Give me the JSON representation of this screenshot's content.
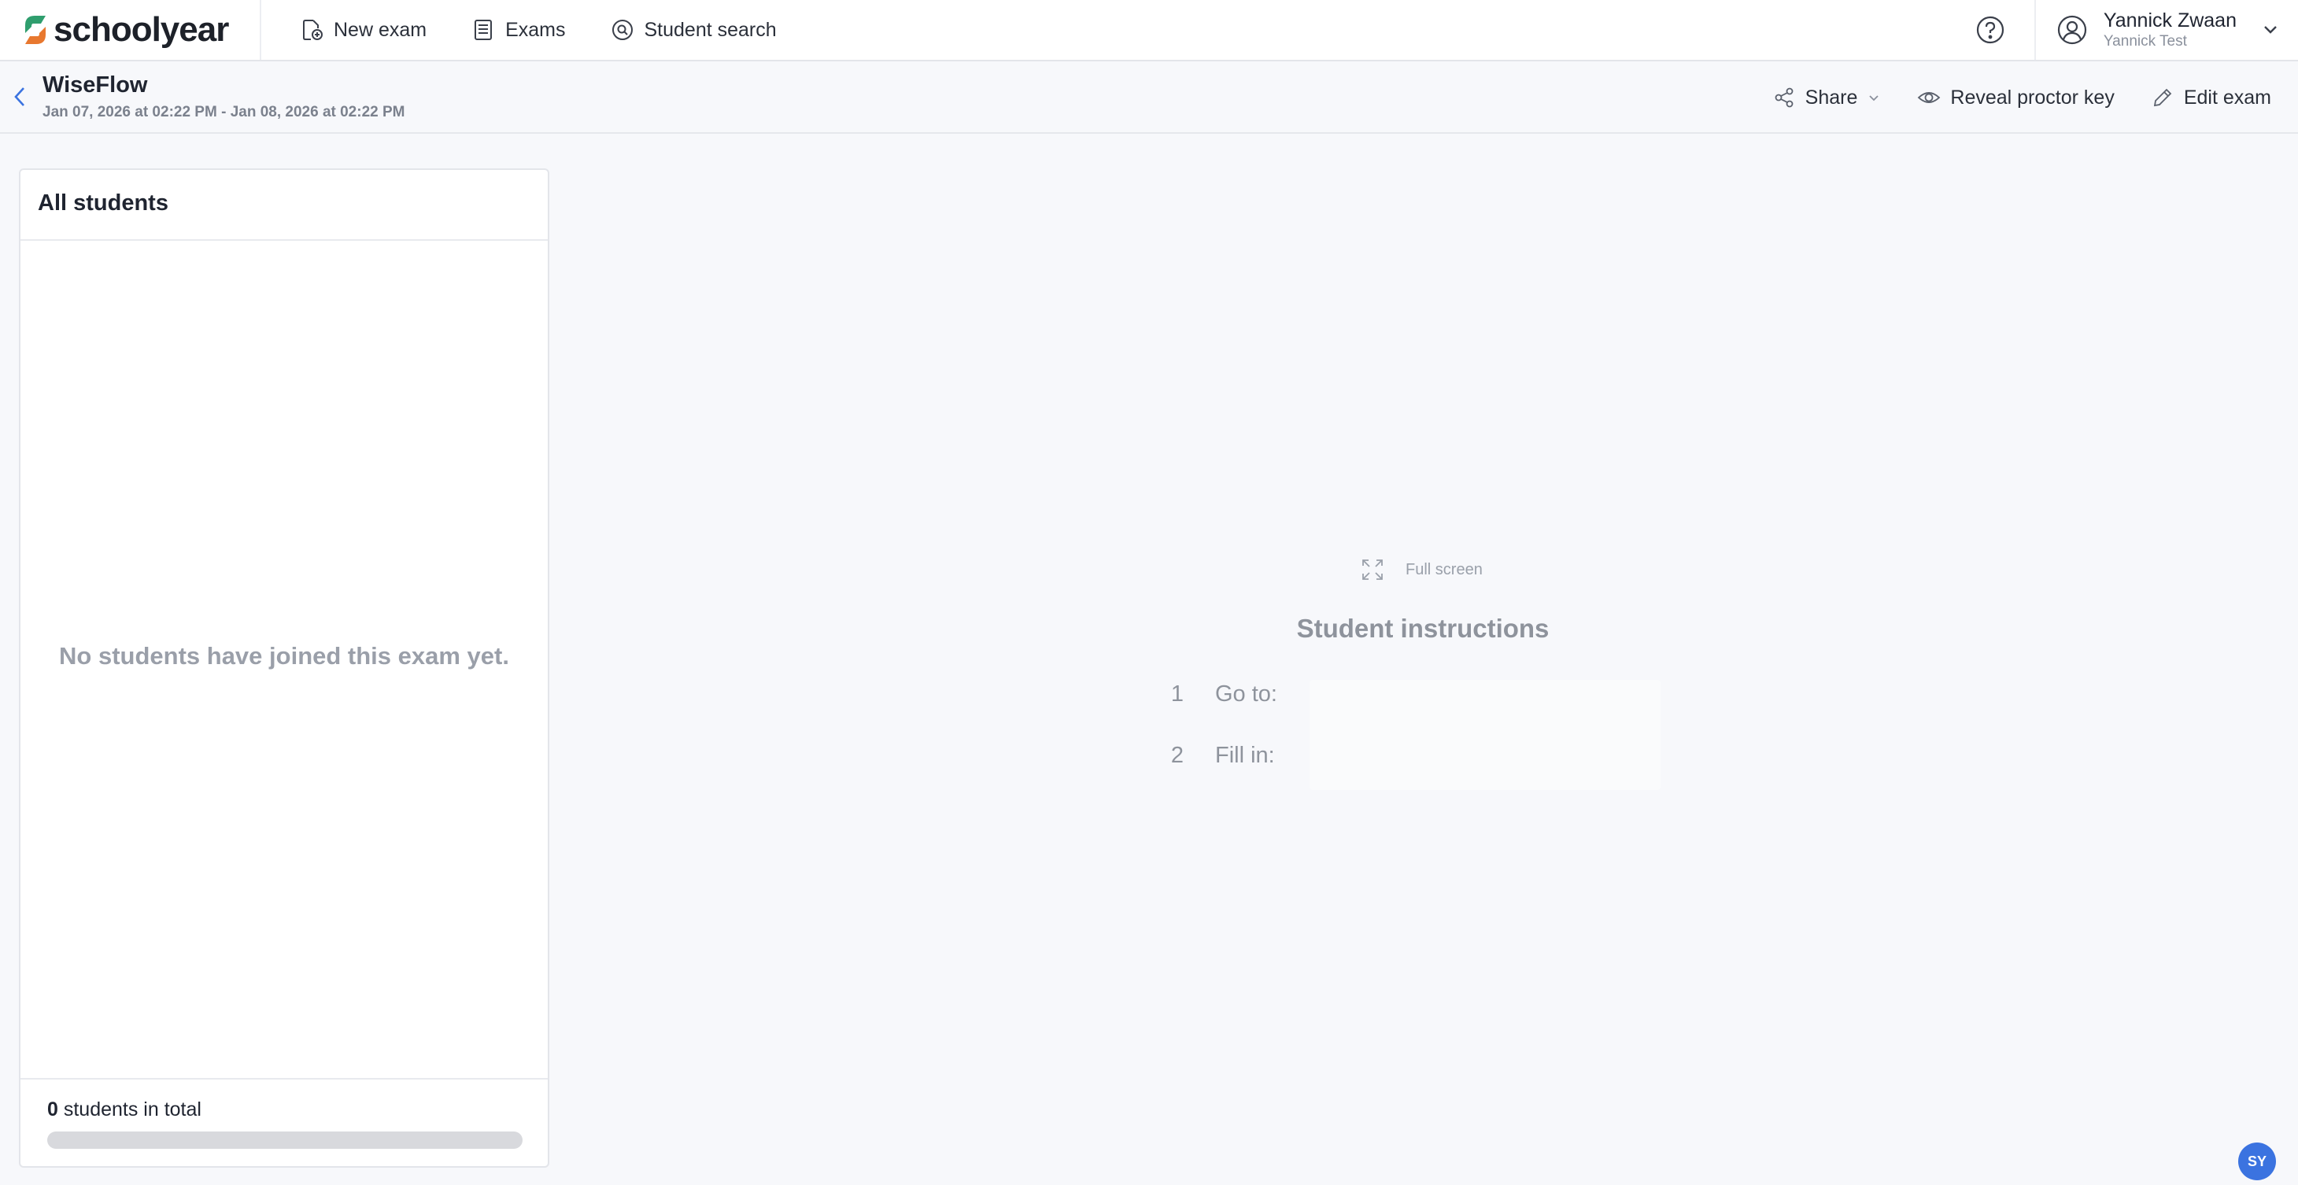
{
  "app": {
    "logo_text": "schoolyear",
    "brand_colors": {
      "green": "#2f9e6e",
      "orange": "#e8782f",
      "accent": "#3b73e0"
    }
  },
  "nav": {
    "items": [
      {
        "label": "New exam",
        "icon": "new-exam-icon"
      },
      {
        "label": "Exams",
        "icon": "exams-list-icon"
      },
      {
        "label": "Student search",
        "icon": "student-search-icon"
      }
    ]
  },
  "user": {
    "name": "Yannick Zwaan",
    "organization": "Yannick Test"
  },
  "exam": {
    "title": "WiseFlow",
    "dates": "Jan 07, 2026 at 02:22 PM - Jan 08, 2026 at 02:22 PM"
  },
  "actions": {
    "share": "Share",
    "reveal": "Reveal proctor key",
    "edit": "Edit exam"
  },
  "students_panel": {
    "title": "All students",
    "empty_message": "No students have joined this exam yet.",
    "total_count": "0",
    "total_suffix": " students in total",
    "progress_fraction": 0
  },
  "instructions": {
    "fullscreen_label": "Full screen",
    "title": "Student instructions",
    "steps": [
      {
        "number": "1",
        "label": "Go to:"
      },
      {
        "number": "2",
        "label": "Fill in:"
      }
    ]
  },
  "badge": {
    "label": "SY"
  }
}
